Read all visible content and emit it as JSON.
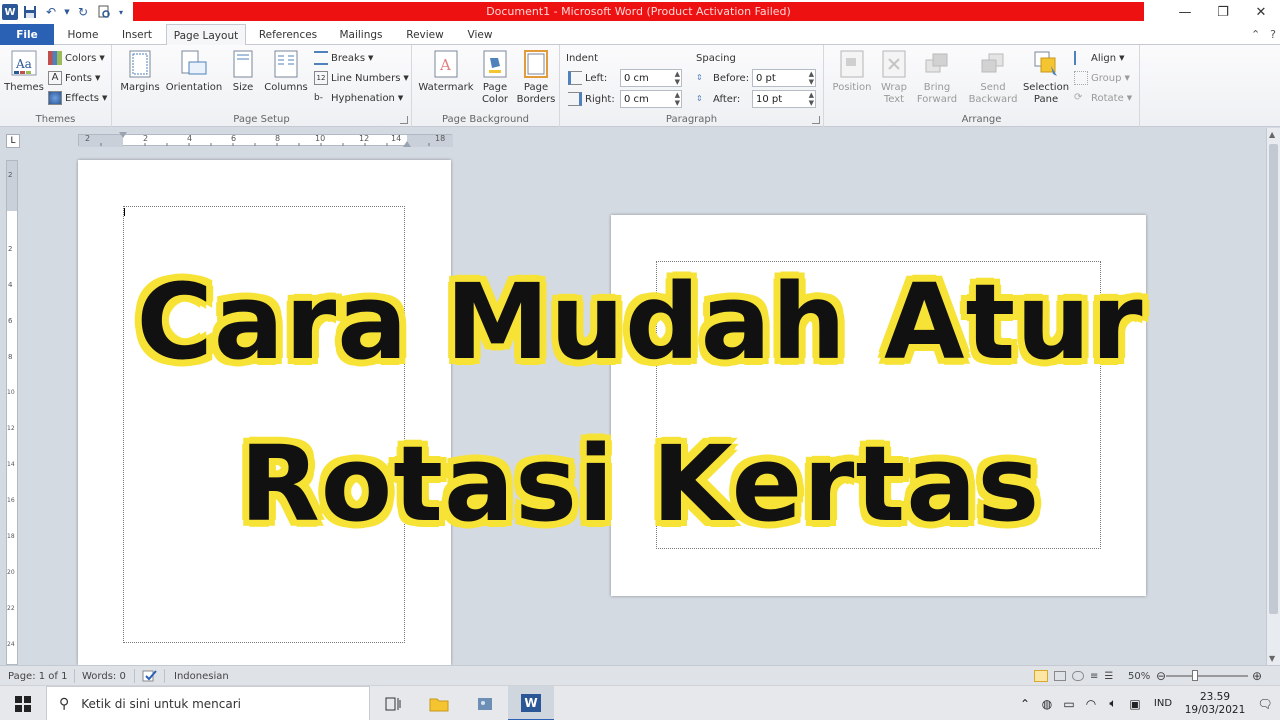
{
  "window": {
    "title": "Document1 - Microsoft Word (Product Activation Failed)"
  },
  "tabs": [
    {
      "label": "File"
    },
    {
      "label": "Home"
    },
    {
      "label": "Insert"
    },
    {
      "label": "Page Layout"
    },
    {
      "label": "References"
    },
    {
      "label": "Mailings"
    },
    {
      "label": "Review"
    },
    {
      "label": "View"
    }
  ],
  "ribbon": {
    "themes": {
      "themes_label": "Themes",
      "colors_label": "Colors",
      "fonts_label": "Fonts",
      "effects_label": "Effects",
      "group_label": "Themes"
    },
    "page_setup": {
      "margins_label": "Margins",
      "orientation_label": "Orientation",
      "size_label": "Size",
      "columns_label": "Columns",
      "breaks_label": "Breaks",
      "line_numbers_label": "Line Numbers",
      "hyphenation_label": "Hyphenation",
      "group_label": "Page Setup"
    },
    "page_background": {
      "watermark_label": "Watermark",
      "page_color_line1": "Page",
      "page_color_line2": "Color",
      "page_borders_line1": "Page",
      "page_borders_line2": "Borders",
      "group_label": "Page Background"
    },
    "paragraph": {
      "indent_label": "Indent",
      "left_label": "Left:",
      "left_value": "0 cm",
      "right_label": "Right:",
      "right_value": "0 cm",
      "spacing_label": "Spacing",
      "before_label": "Before:",
      "before_value": "0 pt",
      "after_label": "After:",
      "after_value": "10 pt",
      "group_label": "Paragraph"
    },
    "arrange": {
      "position_label": "Position",
      "wrap_line1": "Wrap",
      "wrap_line2": "Text",
      "bring_line1": "Bring",
      "bring_line2": "Forward",
      "send_line1": "Send",
      "send_line2": "Backward",
      "selection_line1": "Selection",
      "selection_line2": "Pane",
      "align_label": "Align",
      "group_btn_label": "Group",
      "rotate_label": "Rotate",
      "group_label": "Arrange"
    }
  },
  "ruler": {
    "h_ticks": [
      "2",
      "2",
      "4",
      "6",
      "8",
      "10",
      "12",
      "14",
      "18"
    ],
    "v_ticks": [
      "2",
      "2",
      "4",
      "6",
      "8",
      "10",
      "12",
      "14",
      "16",
      "18",
      "20",
      "22",
      "24"
    ]
  },
  "overlay": {
    "line1": "Cara Mudah Atur",
    "line2": "Rotasi Kertas"
  },
  "statusbar": {
    "page": "Page: 1 of 1",
    "words": "Words: 0",
    "language": "Indonesian",
    "zoom": "50%",
    "zoom_level_percent": 50
  },
  "taskbar": {
    "search_placeholder": "Ketik di sini untuk mencari",
    "lang": "IND",
    "time": "23.59",
    "date": "19/03/2021"
  },
  "colors": {
    "title_red": "#ee1111",
    "file_tab": "#2b61b4",
    "overlay_text": "#111111",
    "overlay_outline": "#f7e236"
  }
}
